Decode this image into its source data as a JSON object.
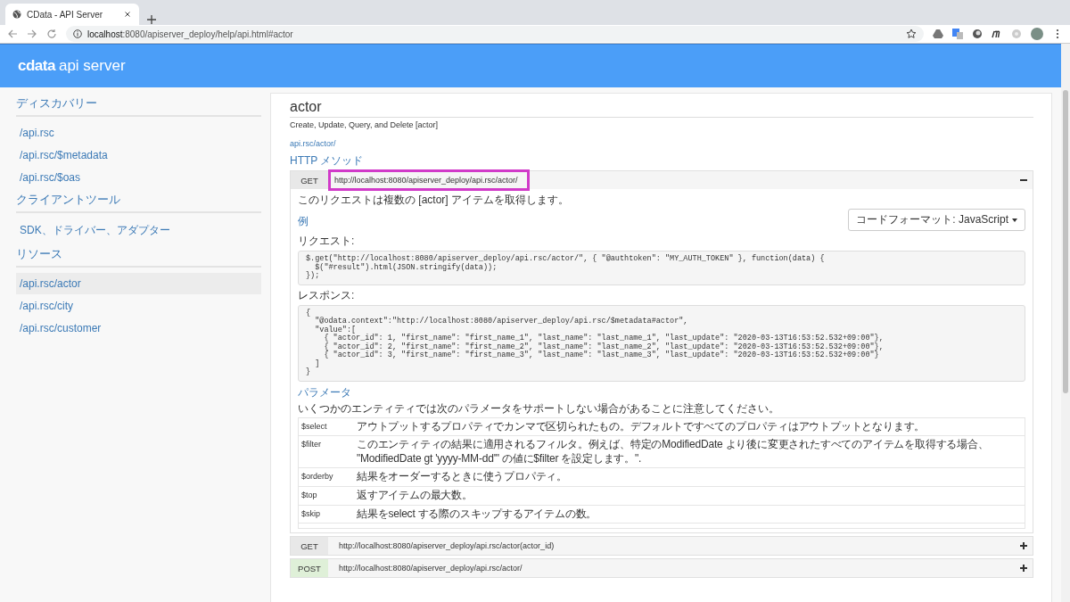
{
  "browser": {
    "tab_title": "CData - API Server",
    "url_host": "localhost",
    "url_rest": ":8080/apiserver_deploy/help/api.html#actor"
  },
  "header": {
    "logo_brand": "cdata",
    "logo_product": "api server"
  },
  "sidebar": {
    "sections": [
      {
        "title": "ディスカバリー",
        "items": [
          {
            "label": "/api.rsc",
            "selected": false
          },
          {
            "label": "/api.rsc/$metadata",
            "selected": false
          },
          {
            "label": "/api.rsc/$oas",
            "selected": false
          }
        ]
      },
      {
        "title": "クライアントツール",
        "items": [
          {
            "label": "SDK、ドライバー、アダプター",
            "selected": false
          }
        ]
      },
      {
        "title": "リソース",
        "items": [
          {
            "label": "/api.rsc/actor",
            "selected": true
          },
          {
            "label": "/api.rsc/city",
            "selected": false
          },
          {
            "label": "/api.rsc/customer",
            "selected": false
          }
        ]
      }
    ]
  },
  "main": {
    "title": "actor",
    "description": "Create, Update, Query, and Delete [actor]",
    "link": "api.rsc/actor/",
    "methods_heading": "HTTP メソッド",
    "endpoints": [
      {
        "method": "GET",
        "color": "#e8e8e8",
        "url": "http://localhost:8080/apiserver_deploy/api.rsc/actor/",
        "highlighted": true,
        "expanded": true,
        "detail": {
          "description": "このリクエストは複数の [actor] アイテムを取得します。",
          "format_button": "コードフォーマット: JavaScript",
          "example_heading": "例",
          "request_label": "リクエスト:",
          "request_code": "$.get(\"http://localhost:8080/apiserver_deploy/api.rsc/actor/\", { \"@authtoken\": \"MY_AUTH_TOKEN\" }, function(data) {\n  $(\"#result\").html(JSON.stringify(data));\n});",
          "response_label": "レスポンス:",
          "response_code": "{\n  \"@odata.context\":\"http://localhost:8080/apiserver_deploy/api.rsc/$metadata#actor\",\n  \"value\":[\n    { \"actor_id\": 1, \"first_name\": \"first_name_1\", \"last_name\": \"last_name_1\", \"last_update\": \"2020-03-13T16:53:52.532+09:00\"},\n    { \"actor_id\": 2, \"first_name\": \"first_name_2\", \"last_name\": \"last_name_2\", \"last_update\": \"2020-03-13T16:53:52.532+09:00\"},\n    { \"actor_id\": 3, \"first_name\": \"first_name_3\", \"last_name\": \"last_name_3\", \"last_update\": \"2020-03-13T16:53:52.532+09:00\"}\n  ]\n}",
          "params_heading": "パラメータ",
          "params_note": "いくつかのエンティティでは次のパラメータをサポートしない場合があることに注意してください。",
          "params": [
            {
              "name": "$select",
              "description": "アウトプットするプロパティでカンマで区切られたもの。デフォルトですべてのプロパティはアウトプットとなります。"
            },
            {
              "name": "$filter",
              "description": "このエンティティの結果に適用されるフィルタ。例えば、特定のModifiedDate より後に変更されたすべてのアイテムを取得する場合、 \"ModifiedDate gt 'yyyy-MM-dd'\" の値に$filter を設定します。\"."
            },
            {
              "name": "$orderby",
              "description": "結果をオーダーするときに使うプロパティ。"
            },
            {
              "name": "$top",
              "description": "返すアイテムの最大数。"
            },
            {
              "name": "$skip",
              "description": "結果をselect する際のスキップするアイテムの数。"
            }
          ]
        }
      },
      {
        "method": "GET",
        "color": "#e8e8e8",
        "url": "http://localhost:8080/apiserver_deploy/api.rsc/actor(actor_id)",
        "highlighted": false,
        "expanded": false
      },
      {
        "method": "POST",
        "color": "#dff0d8",
        "url": "http://localhost:8080/apiserver_deploy/api.rsc/actor/",
        "highlighted": false,
        "expanded": false
      }
    ]
  }
}
